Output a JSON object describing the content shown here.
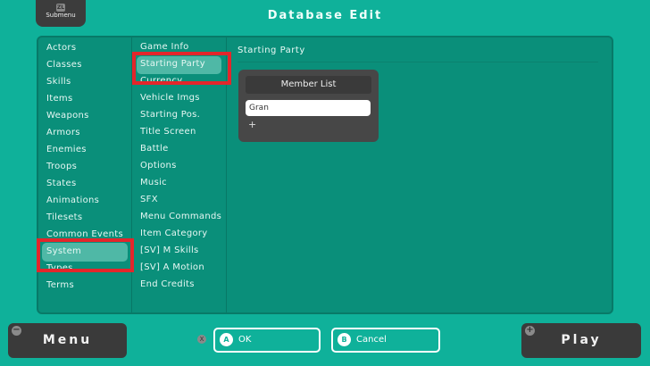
{
  "header": {
    "title": "Database Edit",
    "submenu_label": "Submenu",
    "submenu_key": "ZL"
  },
  "categories": [
    "Actors",
    "Classes",
    "Skills",
    "Items",
    "Weapons",
    "Armors",
    "Enemies",
    "Troops",
    "States",
    "Animations",
    "Tilesets",
    "Common Events",
    "System",
    "Types",
    "Terms"
  ],
  "selected_category": "System",
  "system_tabs": [
    "Game Info",
    "Starting Party",
    "Currency",
    "Vehicle Imgs",
    "Starting Pos.",
    "Title Screen",
    "Battle",
    "Options",
    "Music",
    "SFX",
    "Menu Commands",
    "Item Category",
    "[SV] M Skills",
    "[SV] A Motion",
    "End Credits"
  ],
  "selected_tab": "Starting Party",
  "content": {
    "section_title": "Starting Party",
    "member_list_title": "Member List",
    "members": [
      "Gran"
    ],
    "add_label": "+"
  },
  "footer": {
    "menu_label": "Menu",
    "menu_key": "−",
    "close_key": "X",
    "ok_key": "A",
    "ok_label": "OK",
    "cancel_key": "B",
    "cancel_label": "Cancel",
    "play_label": "Play",
    "play_key": "+"
  },
  "colors": {
    "background": "#0fb19a",
    "panel": "#0a8f7a",
    "highlight": "#e3262b",
    "button": "#3a3a3a"
  }
}
